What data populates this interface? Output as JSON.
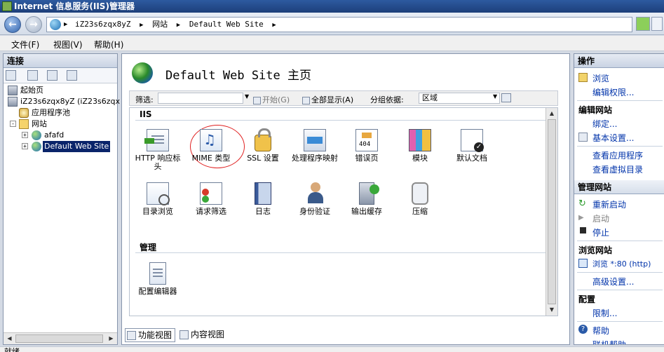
{
  "window": {
    "title": "Internet 信息服务(IIS)管理器"
  },
  "address": {
    "crumbs": [
      "iZ23s6zqx8yZ",
      "网站",
      "Default Web Site"
    ]
  },
  "menu": {
    "items": [
      "文件(F)",
      "视图(V)",
      "帮助(H)"
    ]
  },
  "connections": {
    "header": "连接",
    "tree": {
      "start_page": "起始页",
      "server": "iZ23s6zqx8yZ (iZ23s6zqx",
      "app_pools": "应用程序池",
      "sites": "网站",
      "site1": "afafd",
      "site2": "Default Web Site"
    }
  },
  "main": {
    "title": "Default Web Site 主页",
    "filter": {
      "label": "筛选:",
      "start_label": "开始(G)",
      "show_all_label": "全部显示(A)",
      "group_by_label": "分组依据:",
      "group_by_value": "区域"
    },
    "groups": {
      "iis": {
        "title": "IIS",
        "features": [
          "HTTP 响应标头",
          "MIME 类型",
          "SSL 设置",
          "处理程序映射",
          "错误页",
          "模块",
          "默认文档",
          "目录浏览",
          "请求筛选",
          "日志",
          "身份验证",
          "输出缓存",
          "压缩"
        ]
      },
      "management": {
        "title": "管理",
        "features": [
          "配置编辑器"
        ]
      }
    },
    "bottom_tabs": {
      "features_view": "功能视图",
      "content_view": "内容视图"
    }
  },
  "actions": {
    "header": "操作",
    "items": {
      "browse": "浏览",
      "edit_permissions": "编辑权限...",
      "edit_site_header": "编辑网站",
      "bindings": "绑定...",
      "basic_settings": "基本设置...",
      "view_applications": "查看应用程序",
      "view_virtual_dirs": "查看虚拟目录",
      "manage_site_header": "管理网站",
      "restart": "重新启动",
      "start": "启动",
      "stop": "停止",
      "browse_site_header": "浏览网站",
      "browse_80": "浏览 *:80 (http)",
      "advanced_settings": "高级设置...",
      "config_header": "配置",
      "limits": "限制...",
      "help": "帮助",
      "online_help": "联机帮助"
    }
  },
  "status": {
    "text": "就绪"
  }
}
